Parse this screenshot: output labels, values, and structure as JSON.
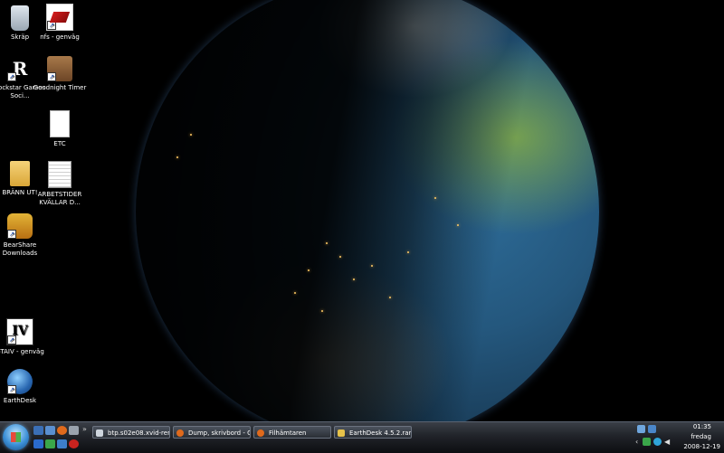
{
  "desktop_icons": [
    {
      "label": "Skräp",
      "icon": "recycle-bin-icon"
    },
    {
      "label": "nfs - genväg",
      "icon": "nfs-shortcut-icon"
    },
    {
      "label": "Rockstar Games Soci...",
      "icon": "rockstar-icon"
    },
    {
      "label": "Goodnight Timer",
      "icon": "timer-icon"
    },
    {
      "label": "ETC",
      "icon": "document-icon"
    },
    {
      "label": "BRÄNN UT!",
      "icon": "folder-icon"
    },
    {
      "label": "ARBETSTIDER KVÄLLAR D...",
      "icon": "spreadsheet-icon"
    },
    {
      "label": "BearShare Downloads",
      "icon": "bearshare-icon"
    },
    {
      "label": "GTAIV - genväg",
      "icon": "gta-icon"
    },
    {
      "label": "EarthDesk",
      "icon": "earthdesk-icon"
    }
  ],
  "taskbar": {
    "tasks": [
      {
        "label": "btp.s02e08.xvid-rem..."
      },
      {
        "label": "Dump, skrivbord - G..."
      },
      {
        "label": "Filhämtaren"
      },
      {
        "label": "EarthDesk 4.5.2.rar"
      }
    ],
    "overflow": "»",
    "clock": {
      "time": "01:35",
      "day": "fredag",
      "date": "2008-12-19"
    }
  },
  "colors": {
    "taskbar": "#202329",
    "start_orb": "#3b8fd6"
  }
}
